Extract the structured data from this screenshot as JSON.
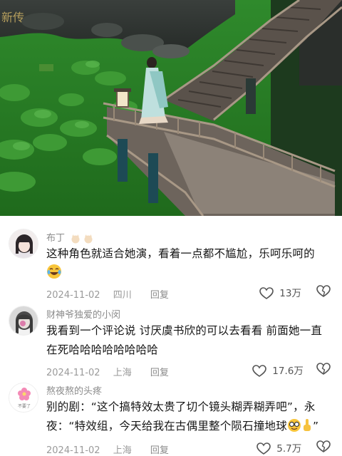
{
  "scene": {
    "image_description_icon": "photo-scene-icon",
    "watermark_text": "新传"
  },
  "comments": [
    {
      "username": "布丁",
      "username_emoji_icons": [
        "cat-face-icon",
        "cat-face-icon"
      ],
      "text": "这种角色就适合她演，看着一点都不尴尬，乐呵乐呵的",
      "trailing_emoji_icon": "laughing-tears-icon",
      "date": "2024-11-02",
      "location": "四川",
      "reply_label": "回复",
      "likes": "13万"
    },
    {
      "username": "财神爷独爱的小闵",
      "text": "我看到一个评论说 讨厌虞书欣的可以去看看 前面她一直在死哈哈哈哈哈哈哈哈",
      "date": "2024-11-02",
      "location": "上海",
      "reply_label": "回复",
      "likes": "17.6万"
    },
    {
      "username": "熬夜熬的头疼",
      "avatar_text": "不要了",
      "text": "别的剧：“这个搞特效太贵了切个镜头糊弄糊弄吧”，永夜：“特效组，今天给我在古偶里整个陨石撞地球",
      "trailing_emoji_icons": [
        "nerd-face-icon",
        "pointing-up-icon"
      ],
      "text_end": "”",
      "date": "2024-11-02",
      "location": "上海",
      "reply_label": "回复",
      "likes": "5.7万"
    }
  ],
  "colors": {
    "water": "#2f7a2a",
    "bridge_wood": "#8a7a6a",
    "meta_gray": "#9a9a9a"
  }
}
